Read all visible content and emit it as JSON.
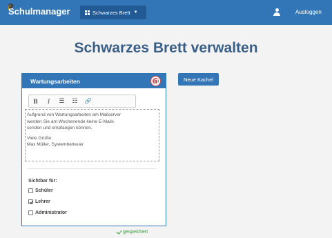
{
  "navbar": {
    "brand": "Schulmanager",
    "board_menu_label": "Schwarzes Brett",
    "logout_label": "Ausloggen"
  },
  "page": {
    "title": "Schwarzes Brett verwalten"
  },
  "actions": {
    "new_tile_label": "Neue Kachel"
  },
  "tile": {
    "title": "Wartungsarbeiten",
    "toolbar": {
      "bold": "B",
      "italic": "I",
      "bullet_list": "☰",
      "numbered_list": "☷",
      "link": "🔗"
    },
    "content": {
      "line1": "Aufgrund von Wartungsarbeiten am Mailserver",
      "line2": "werden Sie am Wochenende keine E-Mails",
      "line3": "senden und empfangen können.",
      "line4": "Viele Grüße",
      "line5": "Max Müller, Systembetreuer"
    },
    "visibility": {
      "label": "Sichtbar für:",
      "options": [
        {
          "label": "Schüler",
          "checked": false
        },
        {
          "label": "Lehrer",
          "checked": true
        },
        {
          "label": "Administrator",
          "checked": false
        }
      ]
    }
  },
  "status": {
    "saved_label": "gespeichert"
  },
  "colors": {
    "primary": "#3276b8",
    "danger": "#d9534f",
    "success": "#3c9a3c"
  }
}
